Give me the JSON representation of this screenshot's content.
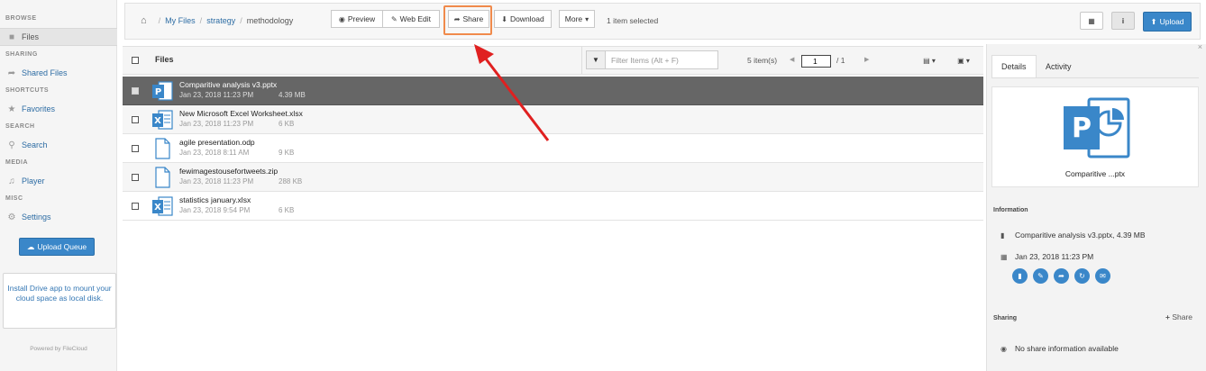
{
  "sidebar": {
    "sections": {
      "browse": "BROWSE",
      "sharing": "SHARING",
      "shortcuts": "SHORTCUTS",
      "search": "SEARCH",
      "media": "MEDIA",
      "misc": "MISC"
    },
    "items": {
      "files": "Files",
      "shared_files": "Shared Files",
      "favorites": "Favorites",
      "search": "Search",
      "player": "Player",
      "settings": "Settings"
    },
    "upload_queue": "Upload Queue",
    "promo": "Install Drive app to mount your cloud space as local disk.",
    "powered_by": "Powered by FileCloud"
  },
  "breadcrumb": {
    "my_files": "My Files",
    "strategy": "strategy",
    "methodology": "methodology"
  },
  "toolbar": {
    "preview": "Preview",
    "web_edit": "Web Edit",
    "share": "Share",
    "download": "Download",
    "more": "More",
    "selection": "1 item selected",
    "upload": "Upload"
  },
  "list": {
    "header": "Files",
    "filter_placeholder": "Filter Items (Alt + F)",
    "item_count": "5 item(s)",
    "page": "1",
    "page_total": "/ 1",
    "files": [
      {
        "name": "Comparitive analysis v3.pptx",
        "date": "Jan 23, 2018 11:23 PM",
        "size": "4.39 MB",
        "type": "pptx"
      },
      {
        "name": "New Microsoft Excel Worksheet.xlsx",
        "date": "Jan 23, 2018 11:23 PM",
        "size": "6 KB",
        "type": "xlsx"
      },
      {
        "name": "agile presentation.odp",
        "date": "Jan 23, 2018 8:11 AM",
        "size": "9 KB",
        "type": "generic"
      },
      {
        "name": "fewimagestousefortweets.zip",
        "date": "Jan 23, 2018 11:23 PM",
        "size": "288 KB",
        "type": "generic"
      },
      {
        "name": "statistics january.xlsx",
        "date": "Jan 23, 2018 9:54 PM",
        "size": "6 KB",
        "type": "xlsx"
      }
    ]
  },
  "details": {
    "tab_details": "Details",
    "tab_activity": "Activity",
    "preview_caption": "Comparitive ...ptx",
    "info_title": "Information",
    "file_info": "Comparitive analysis v3.pptx, 4.39 MB",
    "file_date": "Jan 23, 2018 11:23 PM",
    "sharing_title": "Sharing",
    "add_share": "Share",
    "no_share": "No share information available"
  },
  "colors": {
    "accent": "#3a87c9",
    "highlight": "#f08a4b",
    "arrow": "#e02020",
    "selected_row": "#666666"
  }
}
